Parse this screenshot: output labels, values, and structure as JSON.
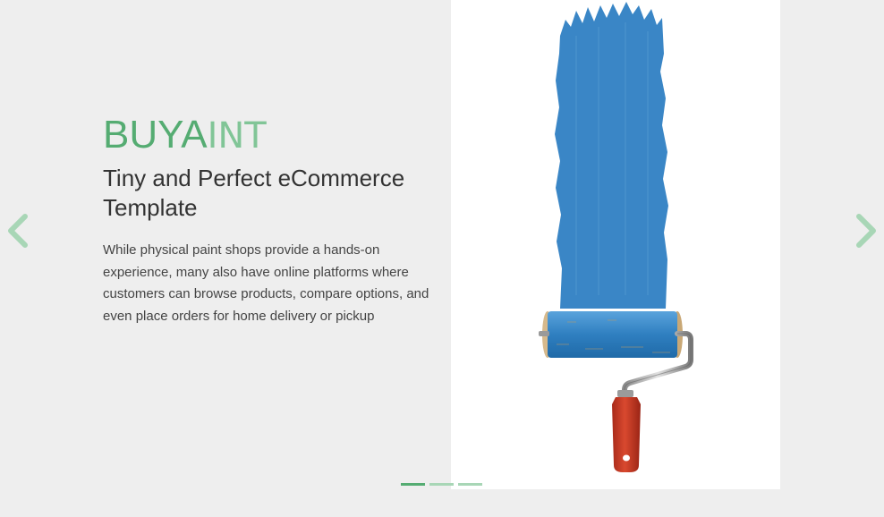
{
  "hero": {
    "brand_strong": "BUYA",
    "brand_light": "INT",
    "subtitle": "Tiny and Perfect eCommerce Template",
    "description": "While physical paint shops provide a hands-on experience, many also have online platforms where customers can browse products, compare options, and even place orders for home delivery or pickup"
  },
  "image": {
    "subject": "paint-roller-icon",
    "paint_color": "#3a86c6",
    "handle_color": "#c93a26"
  },
  "navigation": {
    "prev_icon": "chevron-left-icon",
    "next_icon": "chevron-right-icon",
    "arrow_color": "#a8d6b6"
  },
  "pagination": {
    "total": 3,
    "active_index": 0,
    "active_color": "#55ac72",
    "inactive_color": "#a8d6b6"
  }
}
